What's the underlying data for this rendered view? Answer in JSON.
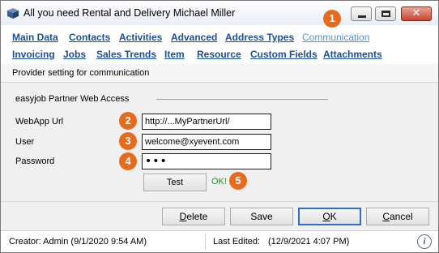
{
  "window": {
    "title": "All you need Rental and Delivery Michael Miller",
    "icons": {
      "app": "cube-icon",
      "minimize": "minimize-icon",
      "maximize": "maximize-icon",
      "close": "close-icon"
    }
  },
  "markers": [
    "1",
    "2",
    "3",
    "4",
    "5"
  ],
  "tabs": {
    "row1": [
      "Main Data",
      "Contacts",
      "Activities",
      "Advanced",
      "Address Types",
      "Communication"
    ],
    "row2": [
      "Invoicing",
      "Jobs",
      "Sales Trends",
      "Item",
      "Resource",
      "Custom Fields",
      "Attachments"
    ],
    "active": "Communication"
  },
  "section": {
    "description": "Provider setting for communication"
  },
  "group": {
    "label": "easyjob Partner Web Access",
    "fields": [
      {
        "label": "WebApp Url",
        "value": "http://...MyPartnerUrl/"
      },
      {
        "label": "User",
        "value": "welcome@xyevent.com"
      },
      {
        "label": "Password",
        "value": "•••"
      }
    ],
    "test_label": "Test",
    "test_result": "OK!"
  },
  "buttons": {
    "delete": {
      "mnemonic": "D",
      "rest": "elete"
    },
    "save": "Save",
    "ok": {
      "mnemonic": "O",
      "rest": "K"
    },
    "cancel": {
      "mnemonic": "C",
      "rest": "ancel"
    }
  },
  "status": {
    "creator": "Creator: Admin  (9/1/2020 9:54 AM)",
    "last_edited_label": "Last Edited:",
    "last_edited_value": "(12/9/2021 4:07 PM)",
    "info_icon": "info-icon"
  },
  "colors": {
    "link": "#1a4e9e",
    "active_link": "#4f8fd6",
    "marker": "#e86a1c",
    "ok_text": "#2f8a2f",
    "close_button": "#c9452f"
  }
}
